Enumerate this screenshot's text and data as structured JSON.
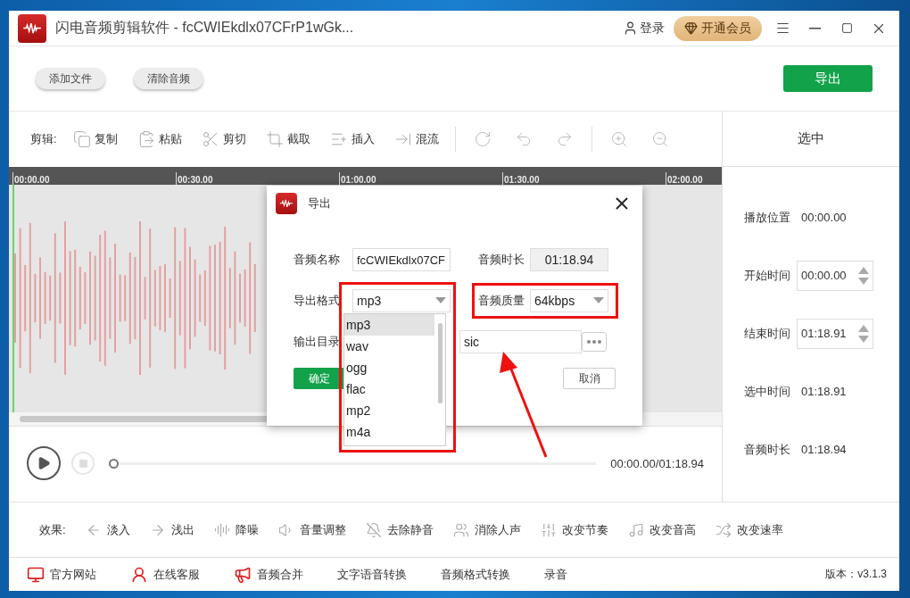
{
  "window": {
    "title": "闪电音频剪辑软件 - fcCWIEkdlx07CFrP1wGk...",
    "login": "登录",
    "vip": "开通会员"
  },
  "top_buttons": [
    "添加文件",
    "清除音频"
  ],
  "export_button": "导出",
  "edit_toolbar": {
    "label": "剪辑:",
    "tools": [
      {
        "label": "复制",
        "kind": "copy"
      },
      {
        "label": "粘贴",
        "kind": "paste"
      },
      {
        "label": "剪切",
        "kind": "cut"
      },
      {
        "label": "截取",
        "kind": "crop"
      },
      {
        "label": "插入",
        "kind": "insert"
      },
      {
        "label": "混流",
        "kind": "mix"
      }
    ]
  },
  "ruler": [
    "00:00.00",
    "00:30.00",
    "01:00.00",
    "01:30.00",
    "02:00.00"
  ],
  "side_panel": {
    "title": "选中",
    "rows": [
      {
        "label": "播放位置",
        "value": "00:00.00",
        "kind": "text"
      },
      {
        "label": "开始时间",
        "value": "00:00.00",
        "kind": "spin"
      },
      {
        "label": "结束时间",
        "value": "01:18.91",
        "kind": "spin"
      },
      {
        "label": "选中时间",
        "value": "01:18.91",
        "kind": "text"
      },
      {
        "label": "音频时长",
        "value": "01:18.94",
        "kind": "text"
      }
    ]
  },
  "player": {
    "time": "00:00.00/01:18.94",
    "level": 0
  },
  "effects": {
    "label": "效果:",
    "items": [
      {
        "label": "淡入",
        "kind": "fade-in"
      },
      {
        "label": "浅出",
        "kind": "fade-out"
      },
      {
        "label": "降噪",
        "kind": "denoise"
      },
      {
        "label": "音量调整",
        "kind": "volume"
      },
      {
        "label": "去除静音",
        "kind": "mute"
      },
      {
        "label": "消除人声",
        "kind": "voice"
      },
      {
        "label": "改变节奏",
        "kind": "tempo"
      },
      {
        "label": "改变音高",
        "kind": "pitch"
      },
      {
        "label": "改变速率",
        "kind": "speed"
      }
    ]
  },
  "footer": {
    "links": [
      {
        "label": "官方网站",
        "kind": "site"
      },
      {
        "label": "在线客服",
        "kind": "service"
      },
      {
        "label": "音频合并",
        "kind": "merge"
      },
      {
        "label": "文字语音转换",
        "kind": "plain"
      },
      {
        "label": "音频格式转换",
        "kind": "plain"
      },
      {
        "label": "录音",
        "kind": "plain"
      }
    ],
    "version": "版本：v3.1.3"
  },
  "dialog": {
    "title": "导出",
    "name_label": "音频名称",
    "name_value": "fcCWIEkdlx07CF",
    "duration_label": "音频时长",
    "duration_value": "01:18.94",
    "format_label": "导出格式",
    "format_value": "mp3",
    "quality_label": "音频质量",
    "quality_value": "64kbps",
    "dir_label": "输出目录",
    "dir_value": "sic",
    "ok": "确定",
    "cancel": "取消",
    "format_options": [
      {
        "label": "mp3",
        "selected": true
      },
      {
        "label": "wav",
        "selected": false
      },
      {
        "label": "ogg",
        "selected": false
      },
      {
        "label": "flac",
        "selected": false
      },
      {
        "label": "mp2",
        "selected": false
      },
      {
        "label": "m4a",
        "selected": false
      }
    ]
  }
}
